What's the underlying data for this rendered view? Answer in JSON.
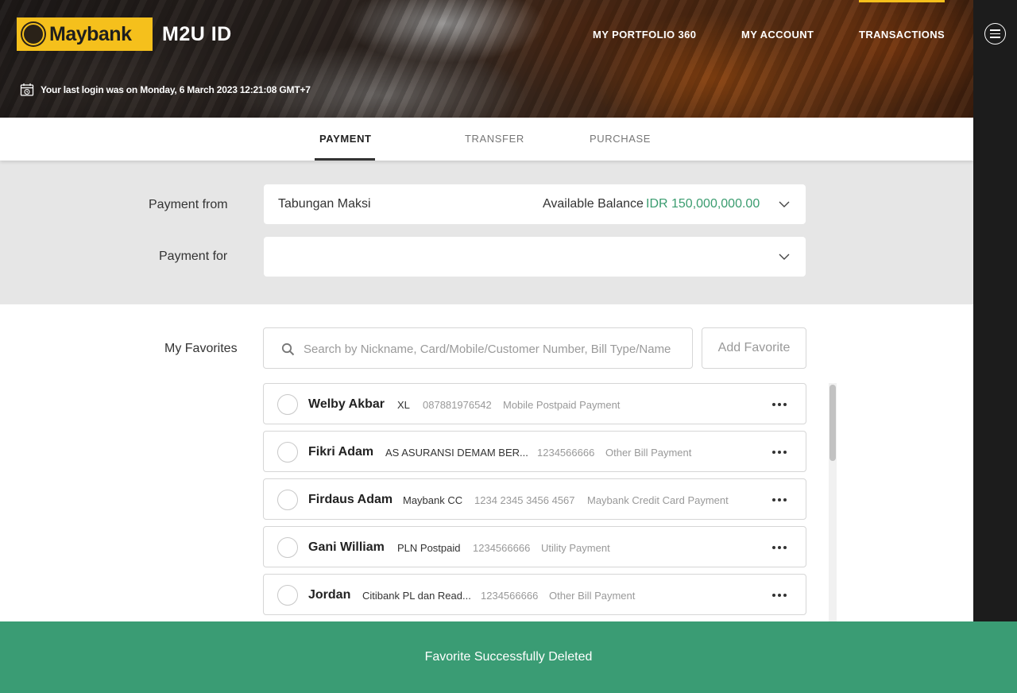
{
  "header": {
    "logo_text": "Maybank",
    "app_title": "M2U ID",
    "nav": {
      "portfolio": "MY PORTFOLIO 360",
      "account": "MY ACCOUNT",
      "transactions": "TRANSACTIONS"
    },
    "last_login": "Your last login was on Monday, 6 March 2023 12:21:08 GMT+7"
  },
  "tabs": [
    {
      "label": "PAYMENT",
      "active": true
    },
    {
      "label": "TRANSFER",
      "active": false
    },
    {
      "label": "PURCHASE",
      "active": false
    }
  ],
  "payment_form": {
    "from_label": "Payment from",
    "from_account": "Tabungan Maksi",
    "balance_label": "Available Balance",
    "balance_value": "IDR 150,000,000.00",
    "for_label": "Payment for",
    "for_value": ""
  },
  "favorites": {
    "label": "My Favorites",
    "search_placeholder": "Search by Nickname, Card/Mobile/Customer Number, Bill Type/Name",
    "add_button": "Add Favorite",
    "items": [
      {
        "name": "Welby Akbar",
        "biller": "XL",
        "number": "087881976542",
        "type": "Mobile Postpaid Payment"
      },
      {
        "name": "Fikri Adam",
        "biller": "AS ASURANSI DEMAM BER...",
        "number": "1234566666",
        "type": "Other Bill Payment"
      },
      {
        "name": "Firdaus Adam",
        "biller": "Maybank CC",
        "number": "1234 2345 3456 4567",
        "type": "Maybank Credit Card Payment"
      },
      {
        "name": "Gani William",
        "biller": "PLN Postpaid",
        "number": "1234566666",
        "type": "Utility Payment"
      },
      {
        "name": "Jordan",
        "biller": "Citibank PL dan Read...",
        "number": "1234566666",
        "type": "Other Bill Payment"
      }
    ]
  },
  "toast": {
    "message": "Favorite Successfully Deleted"
  },
  "colors": {
    "brand_yellow": "#f5c01c",
    "accent_green": "#3a9c74",
    "balance_green": "#3a9c6f"
  }
}
